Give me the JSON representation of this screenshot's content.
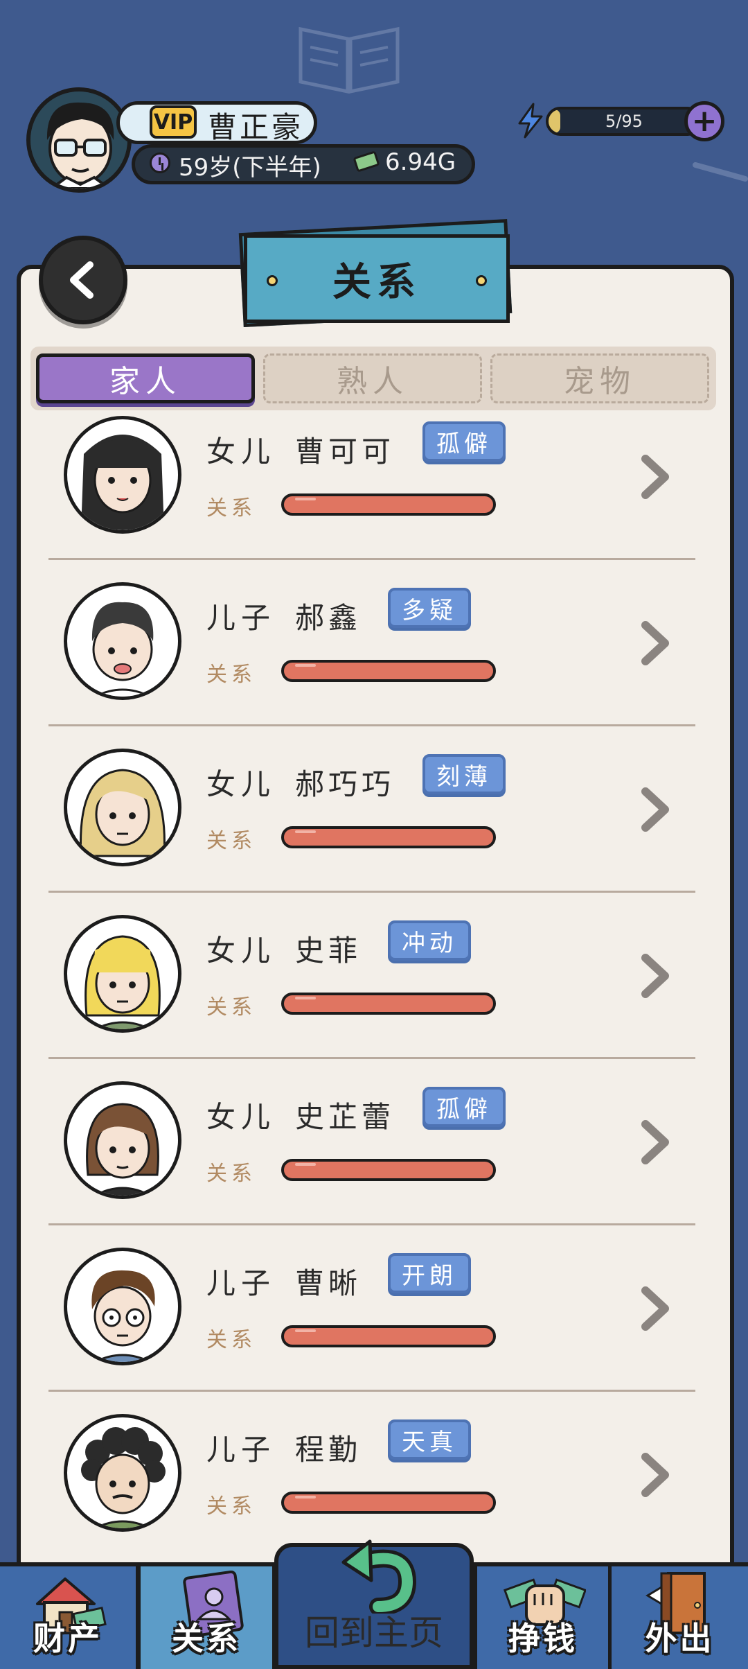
{
  "player": {
    "vip_label": "VIP",
    "name": "曹正豪",
    "age": "59岁(下半年)",
    "money": "6.94G"
  },
  "energy": {
    "text": "5/95",
    "current": 5,
    "max": 95
  },
  "header": {
    "title": "关系"
  },
  "tabs": [
    {
      "label": "家人",
      "active": true
    },
    {
      "label": "熟人",
      "active": false
    },
    {
      "label": "宠物",
      "active": false
    }
  ],
  "relation_label": "关系",
  "members": [
    {
      "relation": "女儿",
      "name": "曹可可",
      "trait": "孤僻"
    },
    {
      "relation": "儿子",
      "name": "郝鑫",
      "trait": "多疑"
    },
    {
      "relation": "女儿",
      "name": "郝巧巧",
      "trait": "刻薄"
    },
    {
      "relation": "女儿",
      "name": "史菲",
      "trait": "冲动"
    },
    {
      "relation": "女儿",
      "name": "史芷蕾",
      "trait": "孤僻"
    },
    {
      "relation": "儿子",
      "name": "曹晰",
      "trait": "开朗"
    },
    {
      "relation": "儿子",
      "name": "程勤",
      "trait": "天真"
    }
  ],
  "nav": {
    "assets": "财产",
    "relations": "关系",
    "home": "回到主页",
    "earn": "挣钱",
    "outing": "外出"
  },
  "colors": {
    "background": "#3f5a8e",
    "paper": "#f3efe9",
    "tab_active": "#9a76c8",
    "trait_badge": "#6c95d8",
    "relation_bar": "#e07561",
    "title_plate": "#57aac5"
  }
}
